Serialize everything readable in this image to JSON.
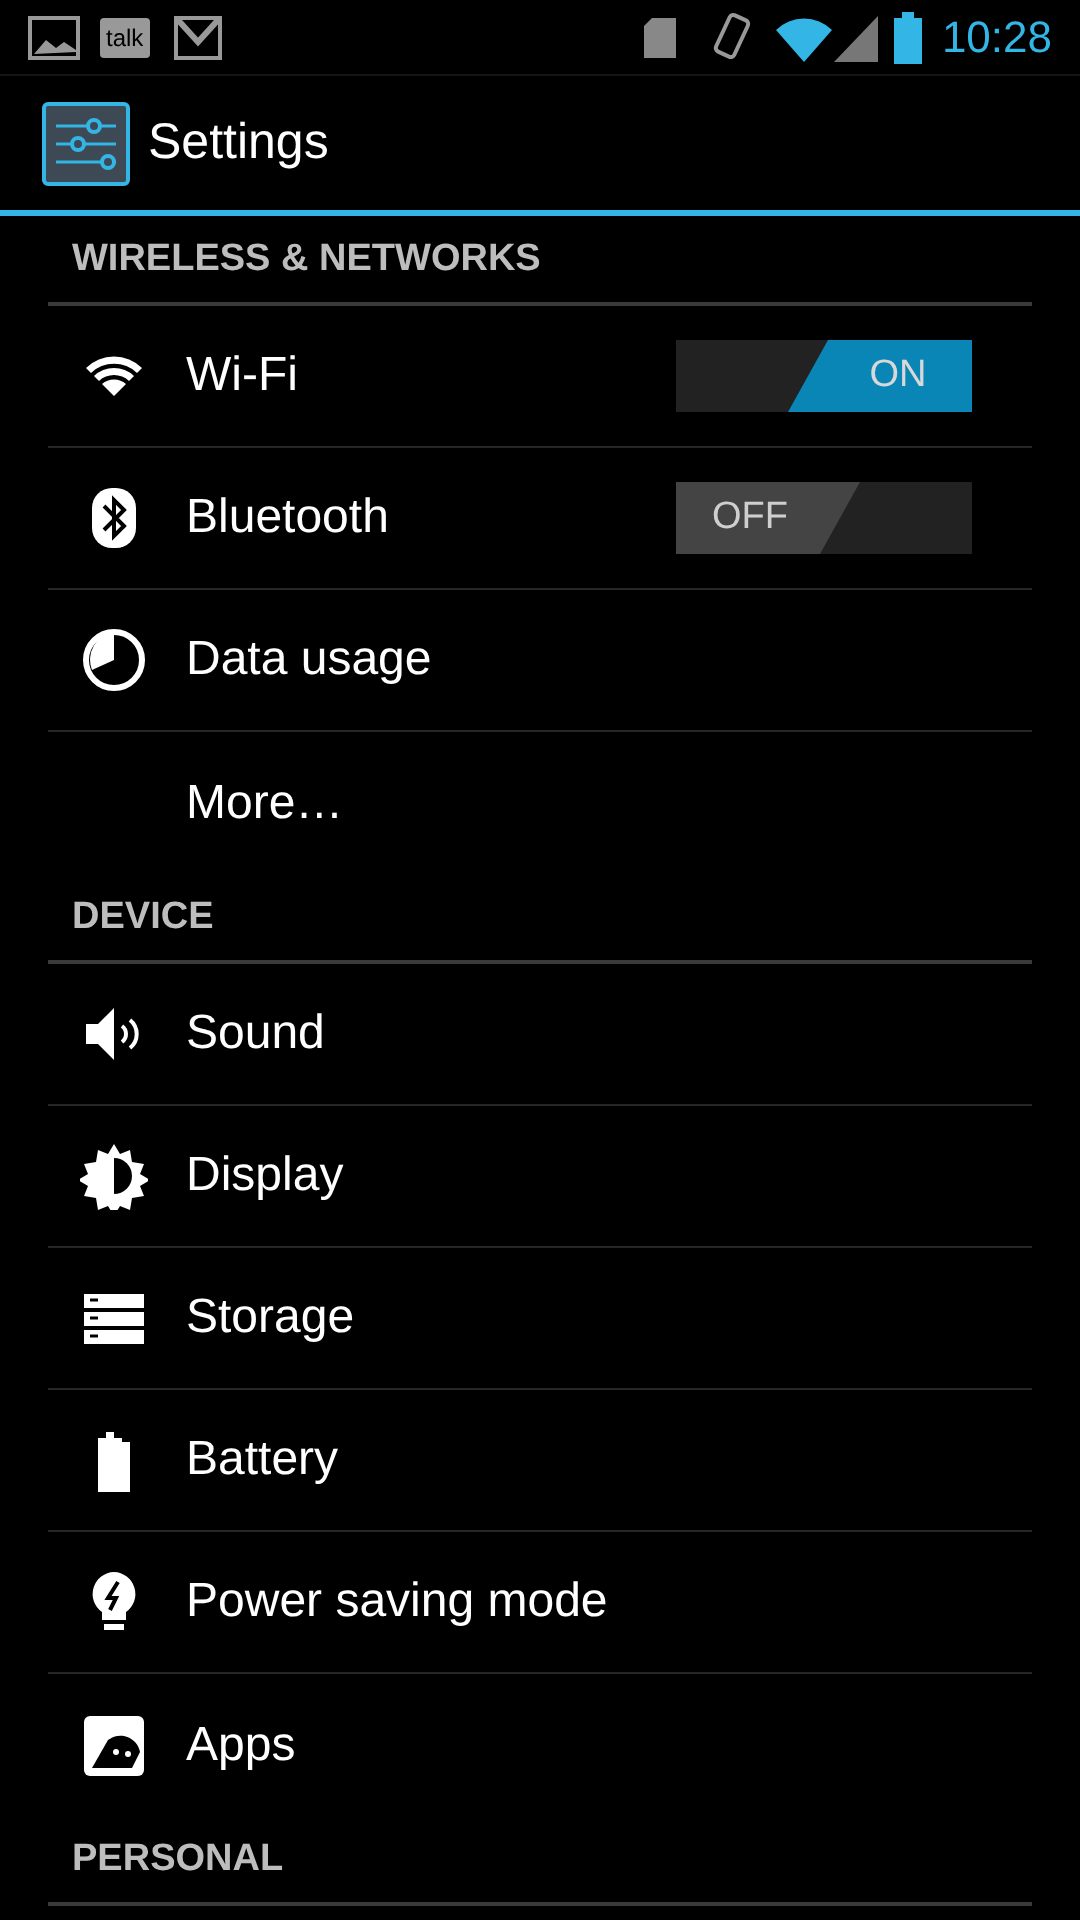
{
  "status_bar": {
    "talk_label": "talk",
    "time": "10:28"
  },
  "action_bar": {
    "title": "Settings"
  },
  "sections": [
    {
      "header": "WIRELESS & NETWORKS",
      "items": [
        {
          "kind": "toggle",
          "label": "Wi-Fi",
          "on": true,
          "switch_text": "ON"
        },
        {
          "kind": "toggle",
          "label": "Bluetooth",
          "on": false,
          "switch_text": "OFF"
        },
        {
          "kind": "plain",
          "label": "Data usage"
        },
        {
          "kind": "plain",
          "label": "More…"
        }
      ]
    },
    {
      "header": "DEVICE",
      "items": [
        {
          "kind": "plain",
          "label": "Sound"
        },
        {
          "kind": "plain",
          "label": "Display"
        },
        {
          "kind": "plain",
          "label": "Storage"
        },
        {
          "kind": "plain",
          "label": "Battery"
        },
        {
          "kind": "plain",
          "label": "Power saving mode"
        },
        {
          "kind": "plain",
          "label": "Apps"
        }
      ]
    },
    {
      "header": "PERSONAL"
    }
  ]
}
